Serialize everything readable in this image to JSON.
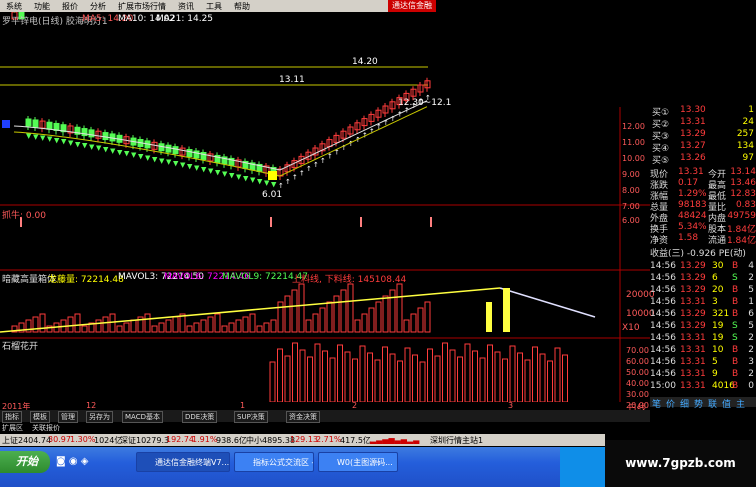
{
  "menu": {
    "items": [
      "系统",
      "功能",
      "报价",
      "分析",
      "扩展市场行情",
      "资讯",
      "工具",
      "帮助"
    ],
    "brand": "通达信金融"
  },
  "chart_header": {
    "title": "罗平锌电(日线) 胶海明灯1",
    "ma5": "MA5: 14.20",
    "ma10": "MA10: 14.02",
    "ma21": "MA21: 14.25"
  },
  "price_axis": [
    "12.00",
    "11.00",
    "10.00",
    "9.00",
    "8.00",
    "7.00",
    "6.00"
  ],
  "annotations": {
    "high_line": "14.20",
    "mid_line": "13.11",
    "low_price": "6.01",
    "range_label": "12.30~12.1"
  },
  "indicator1": {
    "name": "抓牛",
    "value": "抓牛: 0.00"
  },
  "indicator2": {
    "name": "暗藏高量箱体",
    "v1": "龙藤量: 72214.48",
    "v2": "MAVOL3: 72214.50",
    "v3": "MAVOL6: 72214.46",
    "v4": "MAVOL9: 72214.47",
    "v5": "上料线, 下料线: 145108.44",
    "axis": [
      "20000",
      "10000"
    ],
    "axis_unit": "X10"
  },
  "indicator3": {
    "name": "石榴花开",
    "axis": [
      "70.00",
      "60.00",
      "50.00",
      "40.00",
      "30.00",
      "20.00"
    ],
    "axis_unit": "日线"
  },
  "x_axis": {
    "labels": [
      "2011年",
      "12",
      "1",
      "2",
      "3"
    ]
  },
  "tabs": [
    "指标",
    "模板",
    "管理",
    "另存为",
    "MACD基本",
    "DDE决策",
    "SUP决策",
    "资金决策"
  ],
  "tabs2": [
    "扩展区",
    "关联报价"
  ],
  "quote": {
    "bid": [
      {
        "label": "买①",
        "price": "13.30",
        "vol": "1"
      },
      {
        "label": "买②",
        "price": "13.31",
        "vol": "24"
      },
      {
        "label": "买③",
        "price": "13.29",
        "vol": "257"
      },
      {
        "label": "买④",
        "price": "13.27",
        "vol": "134"
      },
      {
        "label": "买⑤",
        "price": "13.26",
        "vol": "97"
      }
    ],
    "stats": [
      {
        "l1": "现价",
        "v1": "13.31",
        "l2": "今开",
        "v2": "13.14"
      },
      {
        "l1": "涨跌",
        "v1": "0.17",
        "l2": "最高",
        "v2": "13.46"
      },
      {
        "l1": "涨幅",
        "v1": "1.29%",
        "l2": "最低",
        "v2": "12.83"
      },
      {
        "l1": "总量",
        "v1": "98183",
        "l2": "量比",
        "v2": "0.83"
      },
      {
        "l1": "外盘",
        "v1": "48424",
        "l2": "内盘",
        "v2": "49759"
      },
      {
        "l1": "换手",
        "v1": "5.34%",
        "l2": "股本",
        "v2": "1.84亿"
      },
      {
        "l1": "净资",
        "v1": "1.58",
        "l2": "流通",
        "v2": "1.84亿"
      }
    ],
    "pe": "收益(三) -0.926 PE(动)",
    "ticks": [
      {
        "t": "14:56",
        "p": "13.29",
        "v": "30",
        "d": "B",
        "n": "4"
      },
      {
        "t": "14:56",
        "p": "13.29",
        "v": "6",
        "d": "S",
        "n": "2"
      },
      {
        "t": "14:56",
        "p": "13.29",
        "v": "20",
        "d": "B",
        "n": "5"
      },
      {
        "t": "14:56",
        "p": "13.31",
        "v": "3",
        "d": "B",
        "n": "1"
      },
      {
        "t": "14:56",
        "p": "13.29",
        "v": "321",
        "d": "B",
        "n": "6"
      },
      {
        "t": "14:56",
        "p": "13.29",
        "v": "19",
        "d": "S",
        "n": "5"
      },
      {
        "t": "14:56",
        "p": "13.31",
        "v": "19",
        "d": "S",
        "n": "2"
      },
      {
        "t": "14:56",
        "p": "13.31",
        "v": "10",
        "d": "B",
        "n": "2"
      },
      {
        "t": "14:56",
        "p": "13.31",
        "v": "5",
        "d": "B",
        "n": "3"
      },
      {
        "t": "14:56",
        "p": "13.31",
        "v": "9",
        "d": "B",
        "n": "2"
      },
      {
        "t": "15:00",
        "p": "13.31",
        "v": "4016",
        "d": "B",
        "n": "0"
      }
    ],
    "bottom_tabs": [
      "笔",
      "价",
      "细",
      "势",
      "联",
      "值",
      "主"
    ]
  },
  "status": {
    "sh": "上证2404.74",
    "sh_chg": "30.97",
    "sh_pct": "1.30%",
    "sh_amt": "1024亿",
    "sz": "深证10279.3",
    "sz_chg": "192.74",
    "sz_pct": "1.91%",
    "sz_amt": "938.6亿",
    "zx": "中小4895.38",
    "zx_chg": "129.13",
    "zx_pct": "2.71%",
    "zx_amt": "417.5亿",
    "site": "深圳行情主站1"
  },
  "taskbar": {
    "start": "开始",
    "task1": "通达信金融终端V7...",
    "task2": "指标公式交流区 -...",
    "task3": "W0(主图源码..."
  },
  "watermark": "www.7gpzb.com",
  "colors": {
    "up": "#ff3c3c",
    "down": "#54fc54",
    "white": "#ffffff",
    "yellow": "#ffff00",
    "magenta": "#ff00ff"
  }
}
